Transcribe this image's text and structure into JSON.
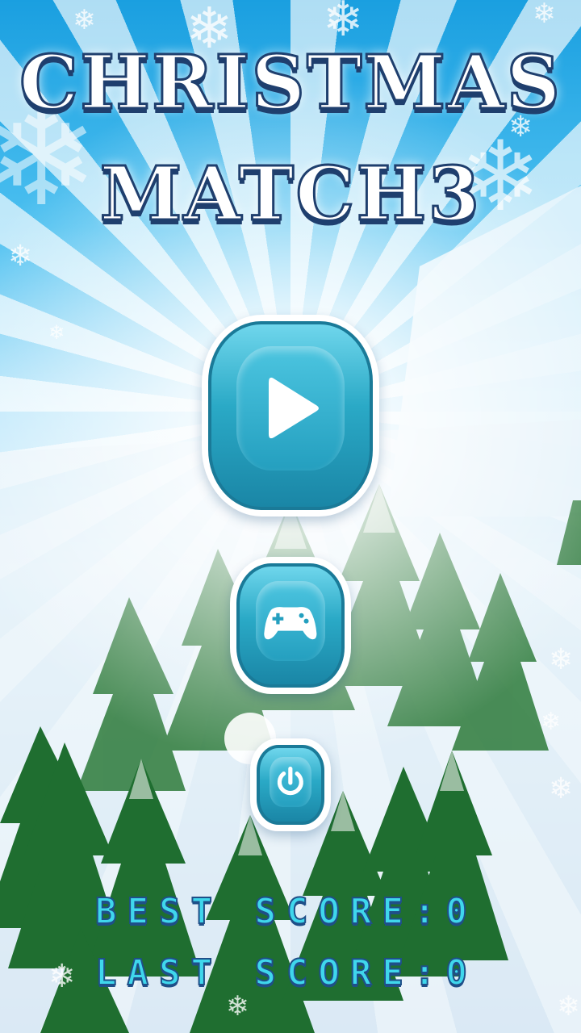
{
  "title": {
    "line1": "CHRISTMAS",
    "line2": "MATCH3"
  },
  "buttons": {
    "play_icon": "play-icon",
    "games_icon": "gamepad-icon",
    "power_icon": "power-icon"
  },
  "scores": {
    "best": "BEST SCORE:0",
    "last": "LAST SCORE:0"
  },
  "colors": {
    "sky": "#1a9fe0",
    "button_teal": "#2aa9c6",
    "score_text": "#3fd7ec",
    "title_outline": "#1f3f6e"
  }
}
